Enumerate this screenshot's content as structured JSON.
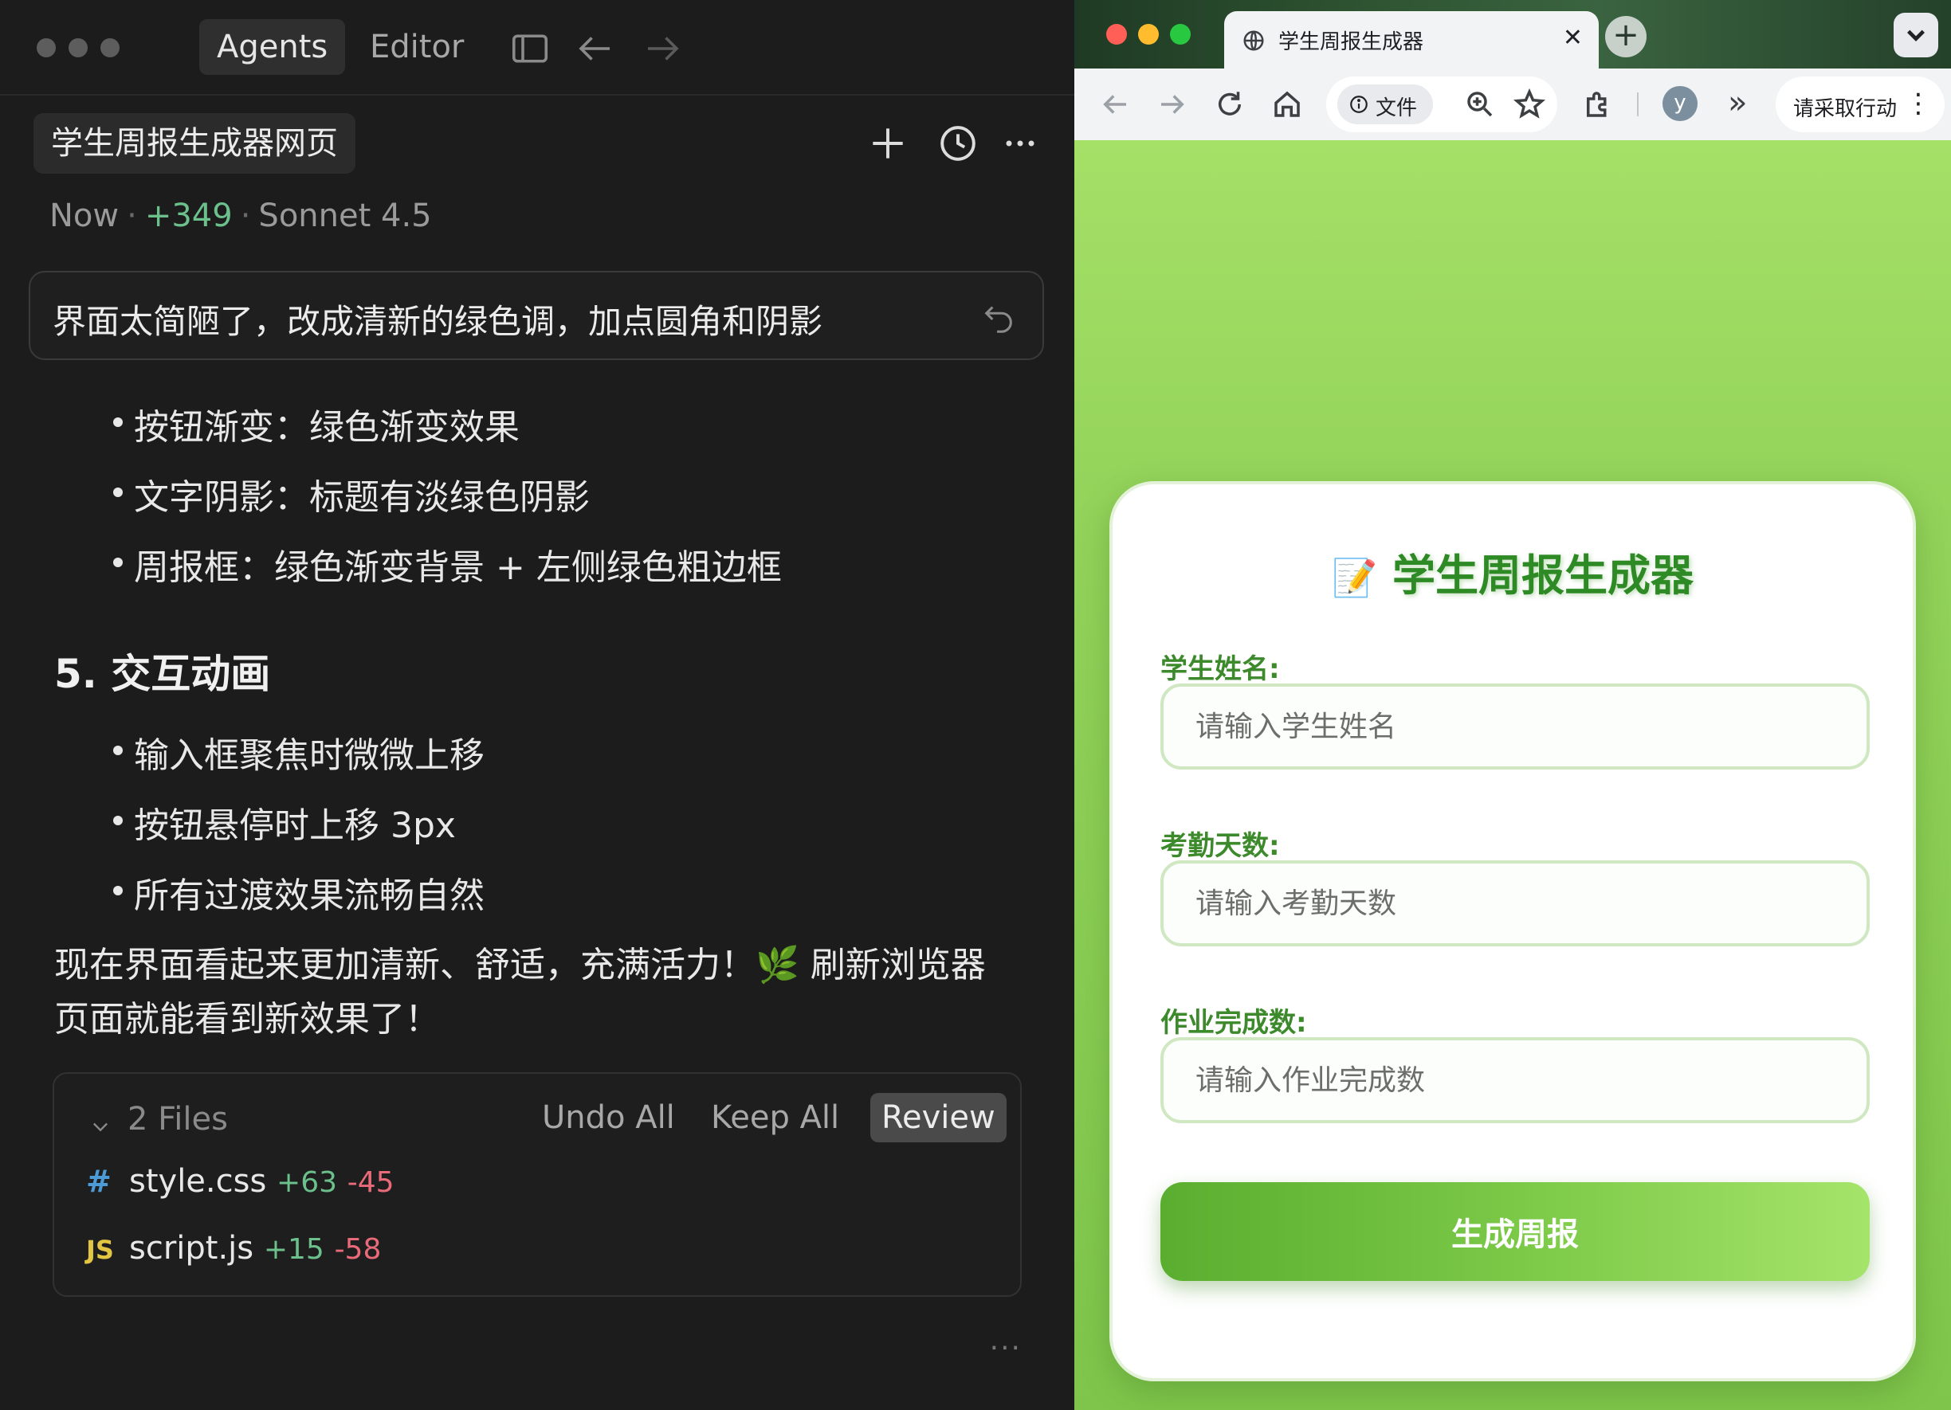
{
  "agent": {
    "tabs": {
      "agents": "Agents",
      "editor": "Editor"
    },
    "chat_title": "学生周报生成器网页",
    "meta": {
      "time": "Now",
      "diff": "+349",
      "model": "Sonnet 4.5"
    },
    "prompt": "界面太简陋了，改成清新的绿色调，加点圆角和阴影",
    "bullets_top": [
      "按钮渐变：绿色渐变效果",
      "文字阴影：标题有淡绿色阴影",
      "周报框：绿色渐变背景 + 左侧绿色粗边框"
    ],
    "section_heading": "5. 交互动画",
    "bullets_anim": [
      "输入框聚焦时微微上移",
      "按钮悬停时上移 3px",
      "所有过渡效果流畅自然"
    ],
    "summary_line1": "现在界面看起来更加清新、舒适，充满活力！🌿 刷新浏览器",
    "summary_line2": "页面就能看到新效果了！",
    "files": {
      "header": "2 Files",
      "undo_all": "Undo All",
      "keep_all": "Keep All",
      "review": "Review",
      "items": [
        {
          "icon": "#",
          "name": "style.css",
          "added": "+63",
          "removed": "-45"
        },
        {
          "icon": "JS",
          "name": "script.js",
          "added": "+15",
          "removed": "-58"
        }
      ]
    },
    "more": "···"
  },
  "browser": {
    "tab_title": "学生周报生成器",
    "tab_close": "✕",
    "new_tab": "+",
    "omnibox_chip": "文件",
    "avatar": "y",
    "action_label": "请采取行动",
    "action_menu": "⋮",
    "overflow": "»",
    "colors": {
      "page_green": "#8fd055",
      "title_green": "#2e8a25",
      "button_green": "#6fbd3e"
    }
  },
  "form": {
    "title_emoji": "📝",
    "title": "学生周报生成器",
    "name_label": "学生姓名:",
    "name_placeholder": "请输入学生姓名",
    "attendance_label": "考勤天数:",
    "attendance_placeholder": "请输入考勤天数",
    "homework_label": "作业完成数:",
    "homework_placeholder": "请输入作业完成数",
    "submit": "生成周报"
  }
}
